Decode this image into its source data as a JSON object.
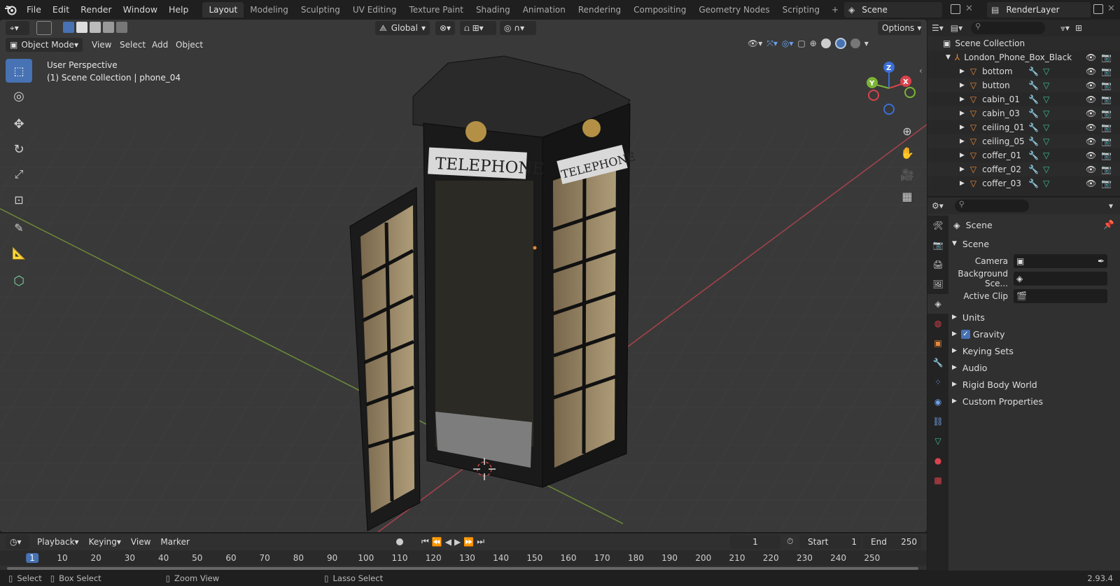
{
  "menu": [
    "File",
    "Edit",
    "Render",
    "Window",
    "Help"
  ],
  "workspaces": [
    "Layout",
    "Modeling",
    "Sculpting",
    "UV Editing",
    "Texture Paint",
    "Shading",
    "Animation",
    "Rendering",
    "Compositing",
    "Geometry Nodes",
    "Scripting"
  ],
  "active_workspace": "Layout",
  "scene_name": "Scene",
  "view_layer": "RenderLayer",
  "viewport": {
    "transform_orientation": "Global",
    "options_label": "Options",
    "mode": "Object Mode",
    "menus": [
      "View",
      "Select",
      "Add",
      "Object"
    ],
    "perspective_label": "User Perspective",
    "collection_label": "(1) Scene Collection | phone_04",
    "sign_text": "TELEPHONE",
    "gizmo": {
      "x": "X",
      "y": "Y",
      "z": "Z"
    }
  },
  "outliner": {
    "root": "Scene Collection",
    "parent": "London_Phone_Box_Black",
    "items": [
      "bottom",
      "button",
      "cabin_01",
      "cabin_03",
      "ceiling_01",
      "ceiling_05",
      "coffer_01",
      "coffer_02",
      "coffer_03"
    ]
  },
  "properties": {
    "context": "Scene",
    "panel": "Scene",
    "fields": [
      {
        "label": "Camera"
      },
      {
        "label": "Background Sce..."
      },
      {
        "label": "Active Clip"
      }
    ],
    "sections": [
      "Units",
      "Gravity",
      "Keying Sets",
      "Audio",
      "Rigid Body World",
      "Custom Properties"
    ],
    "gravity_checked": true
  },
  "timeline": {
    "menus": [
      "Playback",
      "Keying",
      "View",
      "Marker"
    ],
    "current_frame": "1",
    "start_label": "Start",
    "start": "1",
    "end_label": "End",
    "end": "250",
    "ticks": [
      "1",
      "10",
      "20",
      "30",
      "40",
      "50",
      "60",
      "70",
      "80",
      "90",
      "100",
      "110",
      "120",
      "130",
      "140",
      "150",
      "160",
      "170",
      "180",
      "190",
      "200",
      "210",
      "220",
      "230",
      "240",
      "250"
    ]
  },
  "status": {
    "select": "Select",
    "box_select": "Box Select",
    "zoom_view": "Zoom View",
    "lasso_select": "Lasso Select",
    "version": "2.93.4"
  },
  "colors": {
    "accent": "#4772b3",
    "x_axis": "#d9434d",
    "y_axis": "#7db336",
    "z_axis": "#3b6fd6",
    "orange": "#e88a3a"
  }
}
